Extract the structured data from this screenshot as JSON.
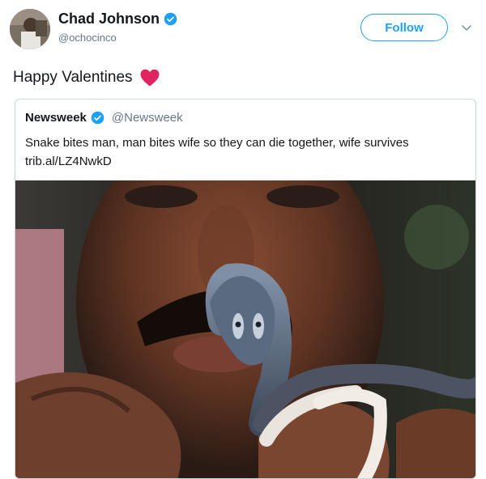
{
  "author": {
    "name": "Chad Johnson",
    "handle": "@ochocinco",
    "verified": true
  },
  "follow_button": {
    "label": "Follow"
  },
  "tweet": {
    "text": "Happy Valentines",
    "emoji": "red-heart"
  },
  "quoted_tweet": {
    "name": "Newsweek",
    "handle": "@Newsweek",
    "verified": true,
    "text": "Snake bites man, man bites wife so they can die together, wife survives trib.al/LZ4NwkD",
    "image": "photo of a man holding a small cobra close to his face"
  },
  "colors": {
    "accent": "#1da1f2",
    "text": "#14171a",
    "muted": "#657786",
    "heart": "#e0245e",
    "border": "#ccd6dd"
  }
}
